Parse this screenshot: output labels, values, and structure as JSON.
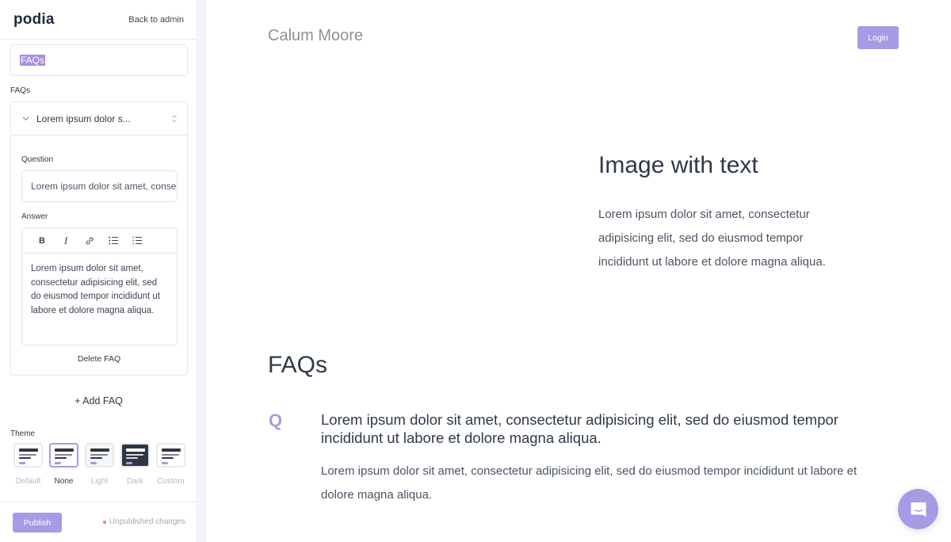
{
  "sidebar": {
    "logo": "podia",
    "back_link": "Back to admin",
    "section_title_value": "FAQs",
    "faqs_label": "FAQs",
    "faq_item": {
      "collapsed_title": "Lorem ipsum dolor s...",
      "question_label": "Question",
      "question_value": "Lorem ipsum dolor sit amet, consectetur adipisicing elit",
      "answer_label": "Answer",
      "toolbar": [
        "bold-icon",
        "italic-icon",
        "link-icon",
        "bullet-list-icon",
        "numbered-list-icon"
      ],
      "toolbar_labels": {
        "bold": "B",
        "italic": "I"
      },
      "answer_value": "Lorem ipsum dolor sit amet, consectetur adipisicing elit, sed do eiusmod tempor incididunt ut labore et dolore magna aliqua.",
      "delete_label": "Delete FAQ"
    },
    "add_faq_label": "+ Add FAQ",
    "theme_label": "Theme",
    "themes": [
      {
        "label": "Default",
        "selected": false
      },
      {
        "label": "None",
        "selected": true
      },
      {
        "label": "Light",
        "selected": false
      },
      {
        "label": "Dark",
        "selected": false
      },
      {
        "label": "Custom",
        "selected": false
      }
    ],
    "publish_label": "Publish",
    "status_text": "Unpublished changes"
  },
  "main": {
    "site_name": "Calum Moore",
    "login_label": "Login",
    "image_with_text": {
      "title": "Image with text",
      "body": "Lorem ipsum dolor sit amet, consectetur adipisicing elit, sed do eiusmod tempor incididunt ut labore et dolore magna aliqua."
    },
    "faqs": {
      "title": "FAQs",
      "q_marker": "Q",
      "items": [
        {
          "question": "Lorem ipsum dolor sit amet, consectetur adipisicing elit, sed do eiusmod tempor incididunt ut labore et dolore magna aliqua.",
          "answer": "Lorem ipsum dolor sit amet, consectetur adipisicing elit, sed do eiusmod tempor incididunt ut labore et dolore magna aliqua."
        }
      ]
    },
    "chat_icon": "chat-bubble-icon"
  },
  "colors": {
    "accent": "#a99ae6",
    "text_dark": "#2e3a48",
    "status_dot": "#f07a6e"
  }
}
